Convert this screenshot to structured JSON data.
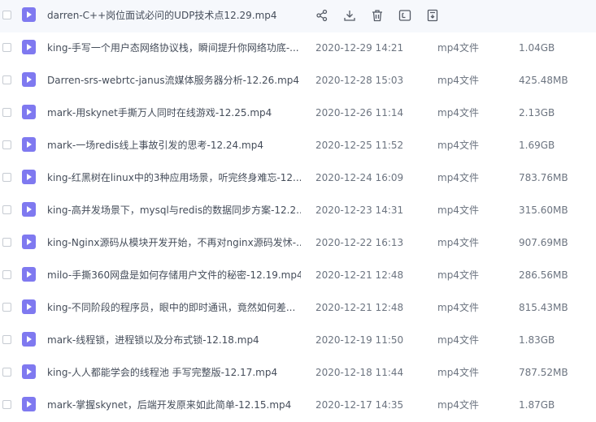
{
  "colors": {
    "file_icon": "#7f79f0",
    "hover_row": "#f6f8fc",
    "text": "#454d5a",
    "muted_text": "#6c7480"
  },
  "first_row_actions": [
    "share-icon",
    "download-icon",
    "delete-icon",
    "rename-icon",
    "more-icon"
  ],
  "files": [
    {
      "name": "darren-C++岗位面试必问的UDP技术点12.29.mp4",
      "date": "",
      "type": "",
      "size": "",
      "icon": "video-file-icon"
    },
    {
      "name": "king-手写一个用户态网络协议栈，瞬间提升你网络功底-...",
      "date": "2020-12-29 14:21",
      "type": "mp4文件",
      "size": "1.04GB",
      "icon": "video-file-icon"
    },
    {
      "name": "Darren-srs-webrtc-janus流媒体服务器分析-12.26.mp4",
      "date": "2020-12-28 15:03",
      "type": "mp4文件",
      "size": "425.48MB",
      "icon": "video-file-icon"
    },
    {
      "name": "mark-用skynet手撕万人同时在线游戏-12.25.mp4",
      "date": "2020-12-26 11:14",
      "type": "mp4文件",
      "size": "2.13GB",
      "icon": "video-file-icon"
    },
    {
      "name": "mark-一场redis线上事故引发的思考-12.24.mp4",
      "date": "2020-12-25 11:52",
      "type": "mp4文件",
      "size": "1.69GB",
      "icon": "video-file-icon"
    },
    {
      "name": "king-红黑树在linux中的3种应用场景，听完终身难忘-12....",
      "date": "2020-12-24 16:09",
      "type": "mp4文件",
      "size": "783.76MB",
      "icon": "video-file-icon"
    },
    {
      "name": "king-高并发场景下，mysql与redis的数据同步方案-12.2...",
      "date": "2020-12-23 14:31",
      "type": "mp4文件",
      "size": "315.60MB",
      "icon": "video-file-icon"
    },
    {
      "name": "king-Nginx源码从模块开发开始，不再对nginx源码发怵-...",
      "date": "2020-12-22 16:13",
      "type": "mp4文件",
      "size": "907.69MB",
      "icon": "video-file-icon"
    },
    {
      "name": "milo-手撕360网盘是如何存储用户文件的秘密-12.19.mp4",
      "date": "2020-12-21 12:48",
      "type": "mp4文件",
      "size": "286.56MB",
      "icon": "video-file-icon"
    },
    {
      "name": "king-不同阶段的程序员，眼中的即时通讯，竟然如何差...",
      "date": "2020-12-21 12:48",
      "type": "mp4文件",
      "size": "815.43MB",
      "icon": "video-file-icon"
    },
    {
      "name": "mark-线程锁，进程锁以及分布式锁-12.18.mp4",
      "date": "2020-12-19 11:50",
      "type": "mp4文件",
      "size": "1.83GB",
      "icon": "video-file-icon"
    },
    {
      "name": "king-人人都能学会的线程池 手写完整版-12.17.mp4",
      "date": "2020-12-18 11:44",
      "type": "mp4文件",
      "size": "787.52MB",
      "icon": "video-file-icon"
    },
    {
      "name": "mark-掌握skynet，后端开发原来如此简单-12.15.mp4",
      "date": "2020-12-17 14:35",
      "type": "mp4文件",
      "size": "1.87GB",
      "icon": "video-file-icon"
    }
  ]
}
